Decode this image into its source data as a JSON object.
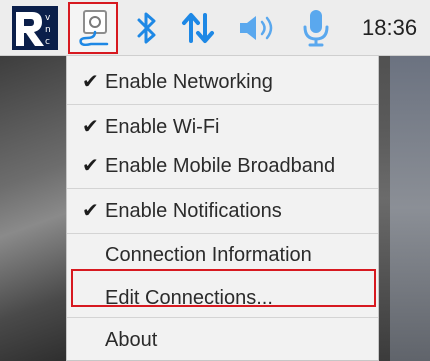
{
  "taskbar": {
    "clock": "18:36",
    "icons": [
      "vnc-logo-icon",
      "network-connections-icon",
      "bluetooth-icon",
      "mobile-data-icon",
      "volume-icon",
      "microphone-icon"
    ]
  },
  "menu": {
    "items": [
      {
        "label": "Enable Networking",
        "checked": true
      },
      {
        "label": "Enable Wi-Fi",
        "checked": true
      },
      {
        "label": "Enable Mobile Broadband",
        "checked": true
      },
      {
        "label": "Enable Notifications",
        "checked": true
      },
      {
        "label": "Connection Information",
        "checked": false
      },
      {
        "label": "Edit Connections...",
        "checked": false
      },
      {
        "label": "About",
        "checked": false
      }
    ],
    "check_glyph": "✔"
  },
  "colors": {
    "accent_blue": "#1e88e5",
    "highlight_red": "#d71920",
    "taskbar_bg": "#ededed",
    "menu_bg": "#f2f2f2"
  }
}
